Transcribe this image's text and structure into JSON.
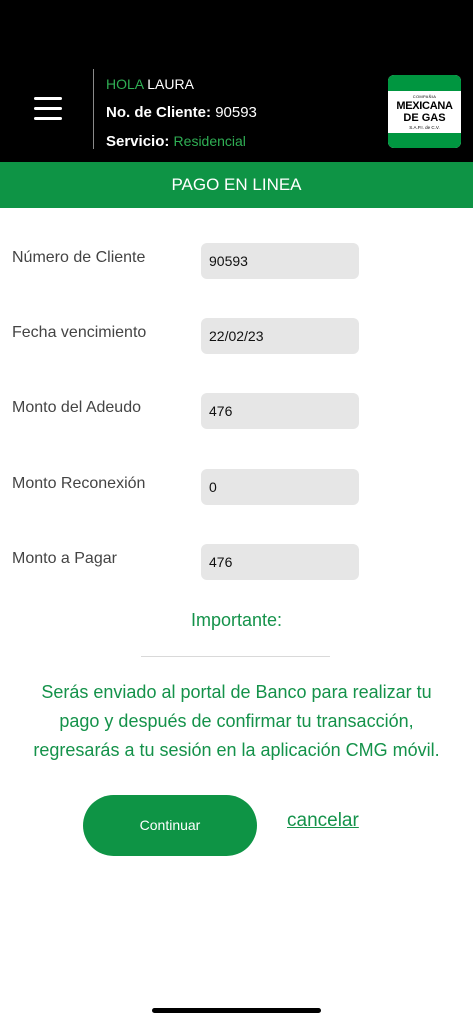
{
  "header": {
    "greeting_prefix": "HOLA",
    "user_name": "LAURA",
    "client_label": "No. de Cliente:",
    "client_number": "90593",
    "service_label": "Servicio:",
    "service_value": "Residencial",
    "logo": {
      "small_text": "COMPAÑIA",
      "line1": "MEXICANA",
      "line2": "DE GAS",
      "line3": "S.A.P.I. de C.V."
    }
  },
  "title_bar": {
    "label": "PAGO EN LINEA"
  },
  "form": {
    "fields": [
      {
        "label": "Número de Cliente",
        "value": "90593"
      },
      {
        "label": "Fecha vencimiento",
        "value": "22/02/23"
      },
      {
        "label": "Monto del Adeudo",
        "value": "476"
      },
      {
        "label": "Monto Reconexión",
        "value": "0"
      },
      {
        "label": "Monto a Pagar",
        "value": "476"
      }
    ]
  },
  "notice": {
    "heading": "Importante:",
    "line1": "Serás enviado al portal de Banco para realizar tu",
    "line2": "pago y después de confirmar tu transacción,",
    "line3": "regresarás a tu sesión en la aplicación CMG móvil."
  },
  "actions": {
    "continue_label": "Continuar",
    "cancel_label": "cancelar"
  },
  "colors": {
    "brand_green": "#0e9445",
    "text_green": "#14924a",
    "header_bg": "#000000"
  }
}
